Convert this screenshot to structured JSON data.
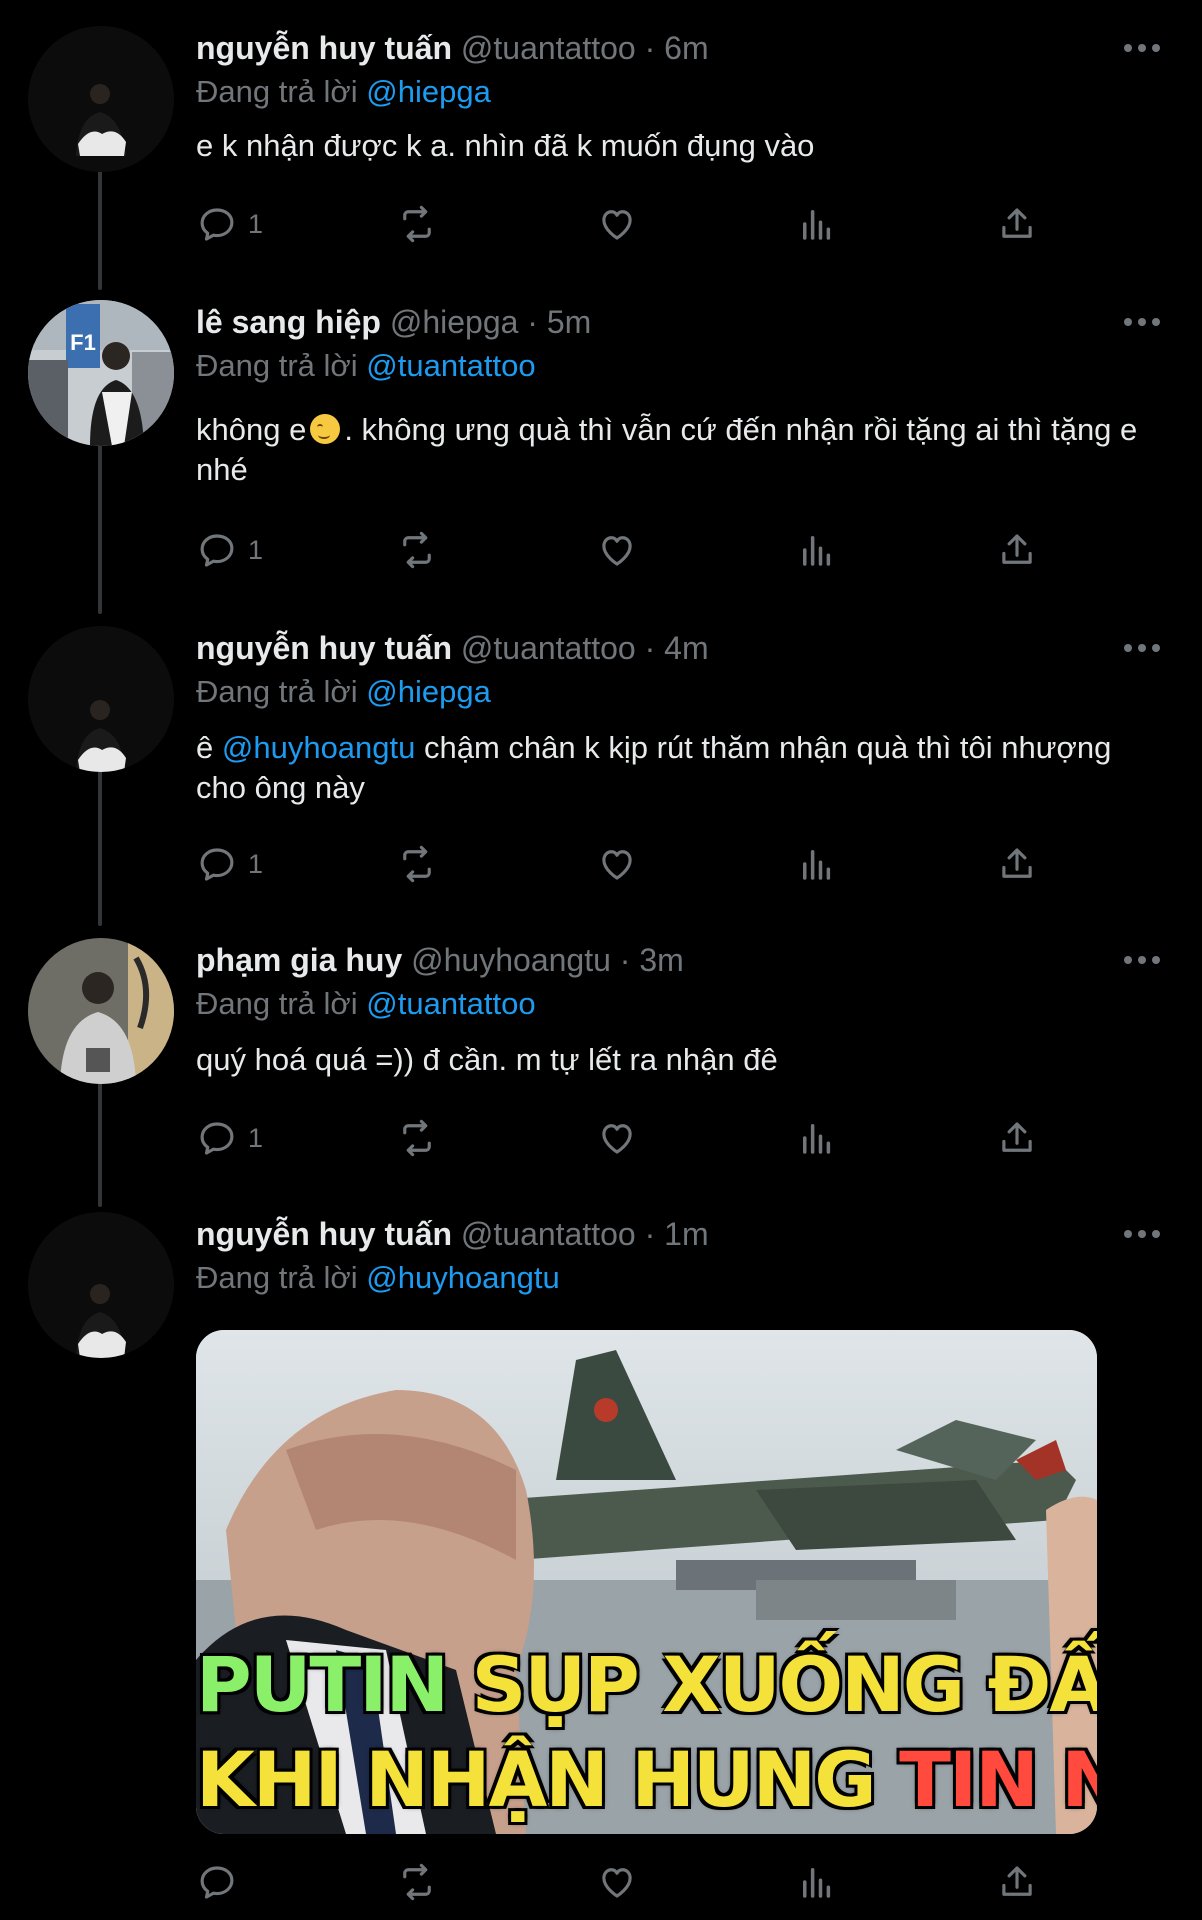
{
  "tweets": [
    {
      "name": "nguyễn huy tuấn",
      "handle": "@tuantattoo",
      "time": "6m",
      "reply_prefix": "Đang trả lời",
      "reply_to": "@hiepga",
      "text": "e k nhận được k a. nhìn đã k muốn đụng vào",
      "reply_count": "1"
    },
    {
      "name": "lê sang hiệp",
      "handle": "@hiepga",
      "time": "5m",
      "reply_prefix": "Đang trả lời",
      "reply_to": "@tuantattoo",
      "text_before_emoji": "không e",
      "text_after_emoji": ". không ưng quà thì vẫn cứ đến nhận rồi tặng ai thì tặng e nhé",
      "reply_count": "1"
    },
    {
      "name": "nguyễn huy tuấn",
      "handle": "@tuantattoo",
      "time": "4m",
      "reply_prefix": "Đang trả lời",
      "reply_to": "@hiepga",
      "text_prefix": "ê",
      "text_mention": "@huyhoangtu",
      "text_rest": "chậm chân k kịp rút thăm nhận quà thì tôi nhượng cho ông này",
      "reply_count": "1"
    },
    {
      "name": "phạm gia huy",
      "handle": "@huyhoangtu",
      "time": "3m",
      "reply_prefix": "Đang trả lời",
      "reply_to": "@tuantattoo",
      "text": "quý hoá quá =)) đ cần. m tự lết ra nhận đê",
      "reply_count": "1"
    },
    {
      "name": "nguyễn huy tuấn",
      "handle": "@tuantattoo",
      "time": "1m",
      "reply_prefix": "Đang trả lời",
      "reply_to": "@huyhoangtu",
      "media_caption": {
        "line1_part1": "PUTIN",
        "line1_part2": "SỤP XUỐNG ĐẤT",
        "line2_part1": "KHI NHẬN HUNG",
        "line2_part2": "TIN NÀY"
      },
      "avatar_sign": "F1",
      "reply_count": ""
    }
  ],
  "separator": "·",
  "icons": [
    "reply-icon",
    "retweet-icon",
    "like-icon",
    "views-icon",
    "share-icon",
    "more-icon"
  ],
  "colors": {
    "background": "#000000",
    "text": "#e7e9ea",
    "muted": "#71767b",
    "link": "#1d9bf0"
  }
}
